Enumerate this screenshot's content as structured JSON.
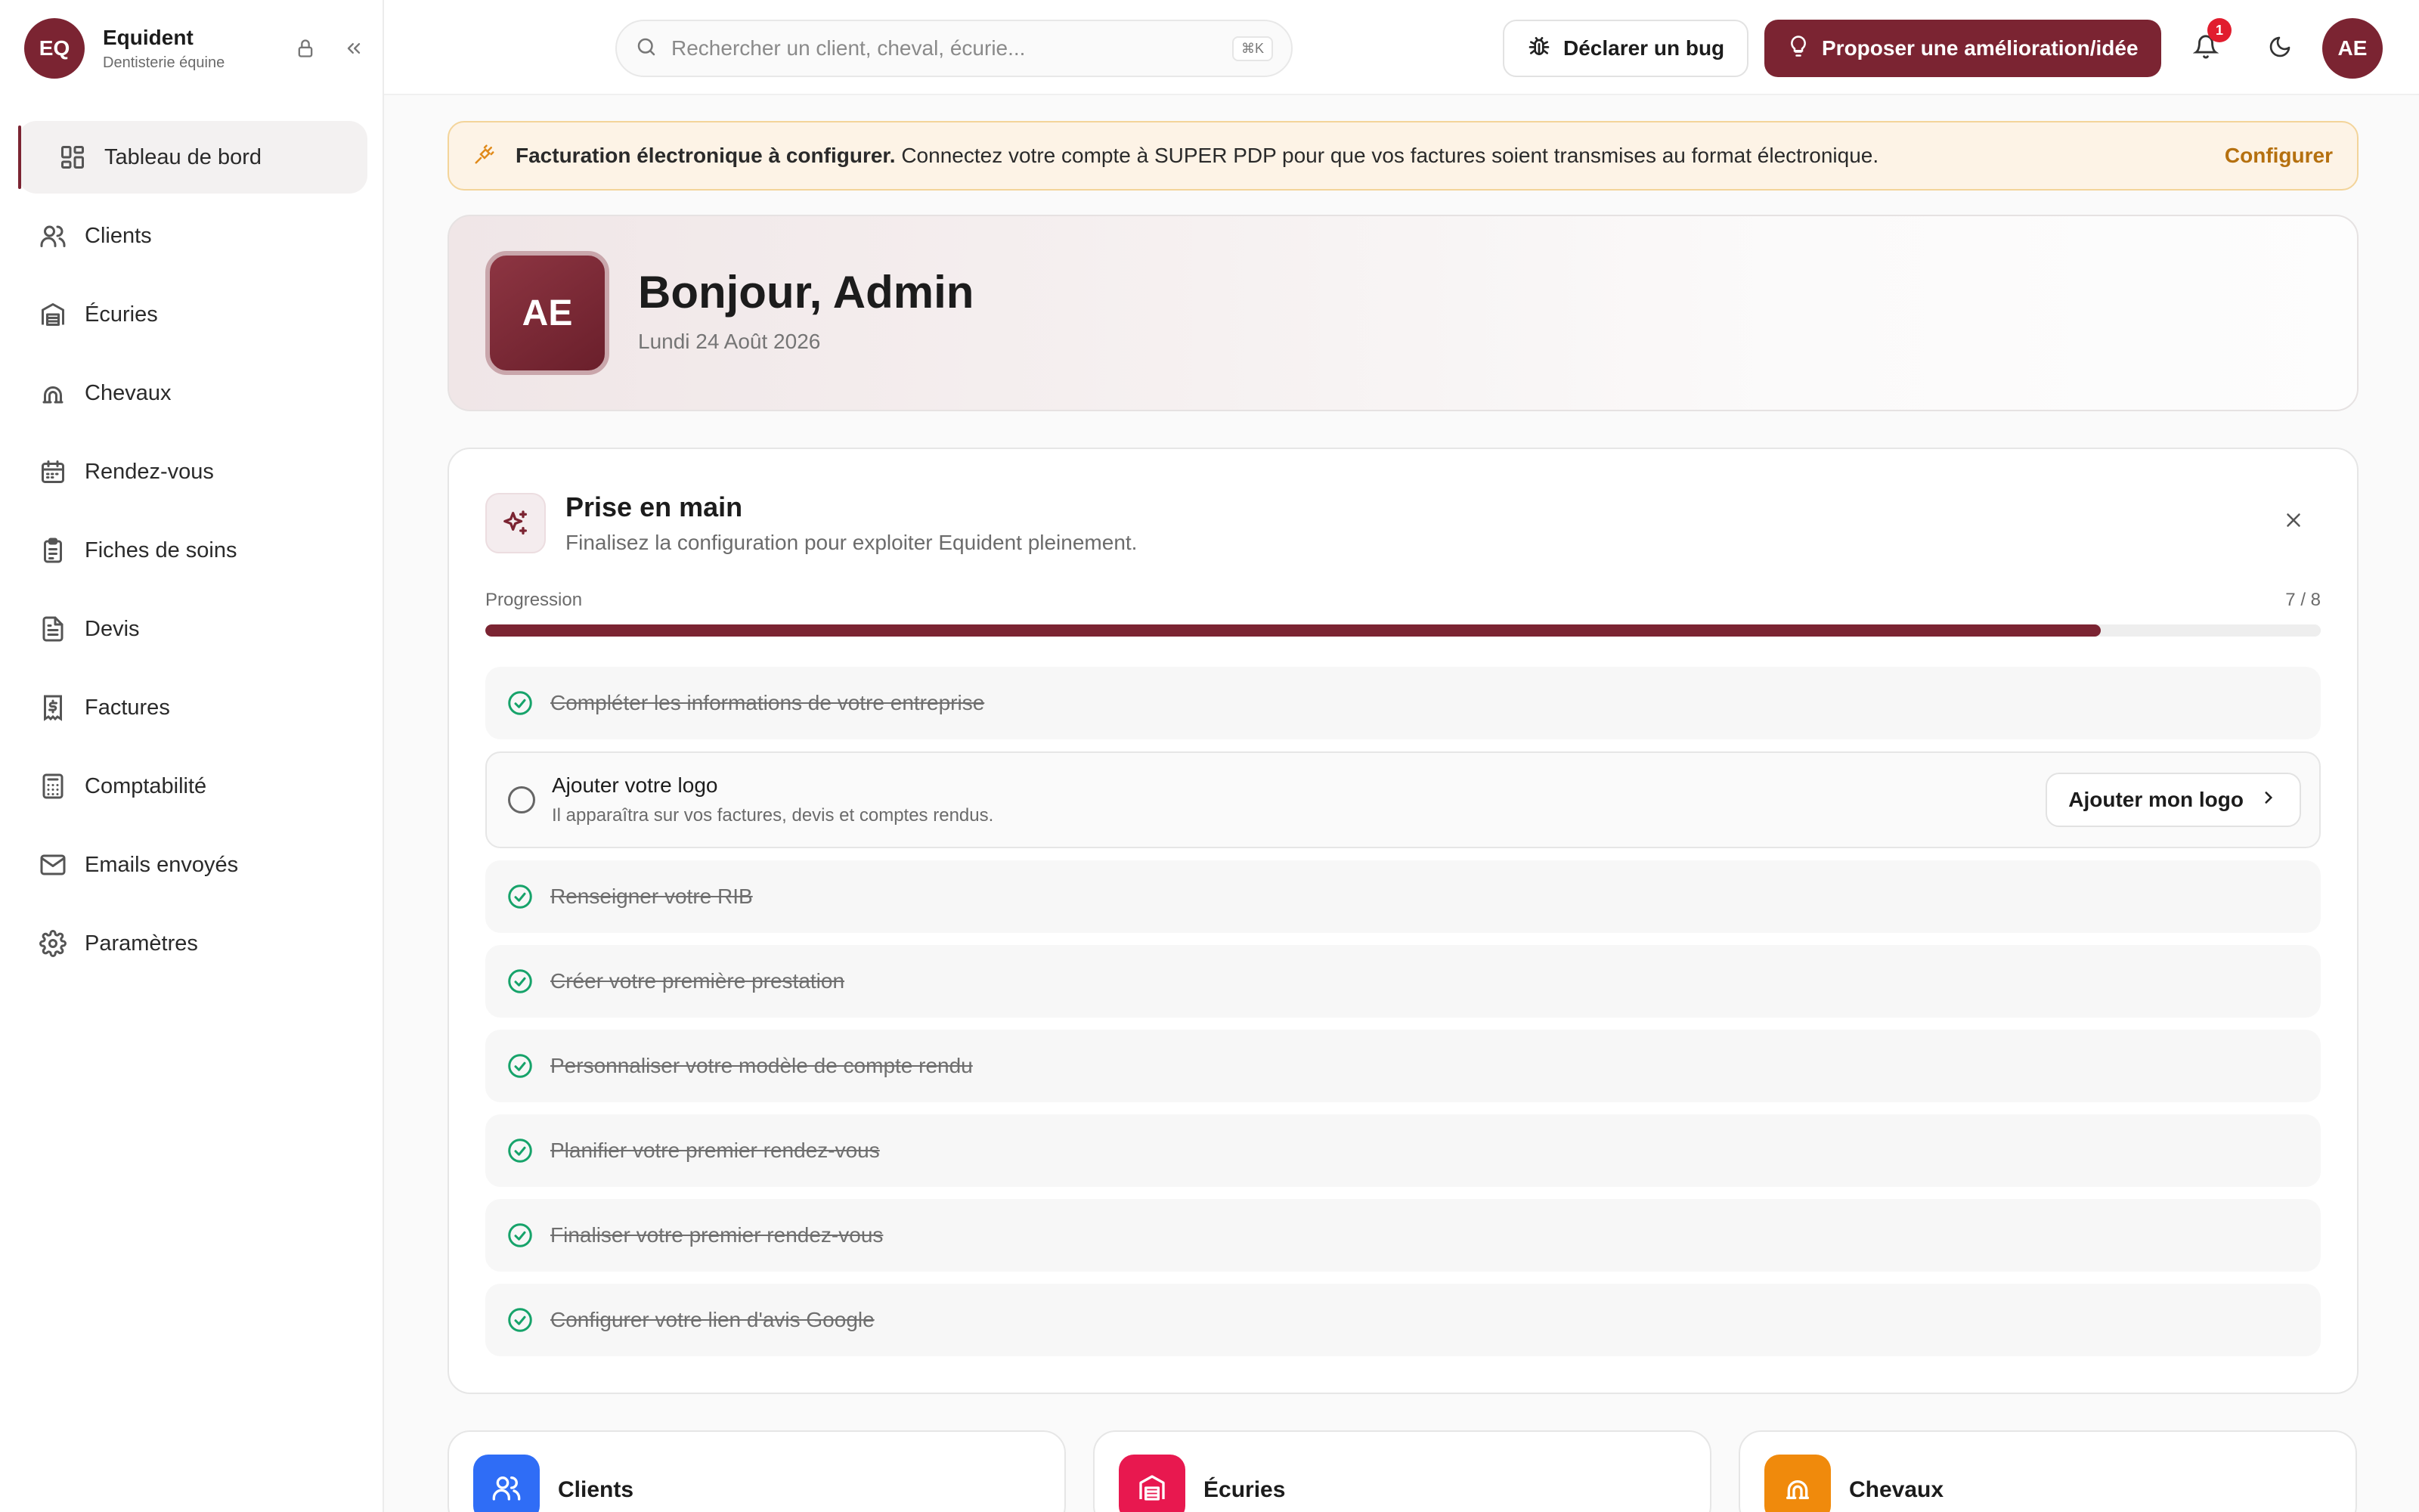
{
  "brand": {
    "initials": "EQ",
    "name": "Equident",
    "subtitle": "Dentisterie équine"
  },
  "sidebar": {
    "items": [
      {
        "label": "Tableau de bord",
        "icon": "dashboard-icon",
        "active": true
      },
      {
        "label": "Clients",
        "icon": "users-icon"
      },
      {
        "label": "Écuries",
        "icon": "warehouse-icon"
      },
      {
        "label": "Chevaux",
        "icon": "horseshoe-icon"
      },
      {
        "label": "Rendez-vous",
        "icon": "calendar-icon"
      },
      {
        "label": "Fiches de soins",
        "icon": "clipboard-icon"
      },
      {
        "label": "Devis",
        "icon": "file-text-icon"
      },
      {
        "label": "Factures",
        "icon": "invoice-dollar-icon"
      },
      {
        "label": "Comptabilité",
        "icon": "calculator-icon"
      },
      {
        "label": "Emails envoyés",
        "icon": "mail-icon"
      },
      {
        "label": "Paramètres",
        "icon": "gear-icon"
      }
    ]
  },
  "topbar": {
    "search_placeholder": "Rechercher un client, cheval, écurie...",
    "search_shortcut": "⌘K",
    "bug_button": "Déclarer un bug",
    "idea_button": "Proposer une amélioration/idée",
    "notification_count": "1",
    "user_initials": "AE"
  },
  "banner": {
    "title": "Facturation électronique à configurer.",
    "message": "Connectez votre compte à SUPER PDP pour que vos factures soient transmises au format électronique.",
    "action": "Configurer"
  },
  "hero": {
    "initials": "AE",
    "greeting": "Bonjour, Admin",
    "date": "Lundi 24 Août 2026"
  },
  "onboarding": {
    "title": "Prise en main",
    "subtitle": "Finalisez la configuration pour exploiter Equident pleinement.",
    "progress_label": "Progression",
    "progress_text": "7 / 8",
    "progress_fraction": 0.88,
    "steps": [
      {
        "label": "Compléter les informations de votre entreprise",
        "done": true
      },
      {
        "label": "Ajouter votre logo",
        "done": false,
        "description": "Il apparaîtra sur vos factures, devis et comptes rendus.",
        "action": "Ajouter mon logo"
      },
      {
        "label": "Renseigner votre RIB",
        "done": true
      },
      {
        "label": "Créer votre première prestation",
        "done": true
      },
      {
        "label": "Personnaliser votre modèle de compte rendu",
        "done": true
      },
      {
        "label": "Planifier votre premier rendez-vous",
        "done": true
      },
      {
        "label": "Finaliser votre premier rendez-vous",
        "done": true
      },
      {
        "label": "Configurer votre lien d'avis Google",
        "done": true
      }
    ]
  },
  "stats": [
    {
      "label": "Clients",
      "color": "#2f6df6",
      "icon": "users-icon"
    },
    {
      "label": "Écuries",
      "color": "#e8184f",
      "icon": "warehouse-icon"
    },
    {
      "label": "Chevaux",
      "color": "#f08a0c",
      "icon": "horseshoe-icon"
    }
  ],
  "colors": {
    "primary": "#7b2432",
    "success": "#16a36a",
    "warning": "#e08a1a"
  }
}
